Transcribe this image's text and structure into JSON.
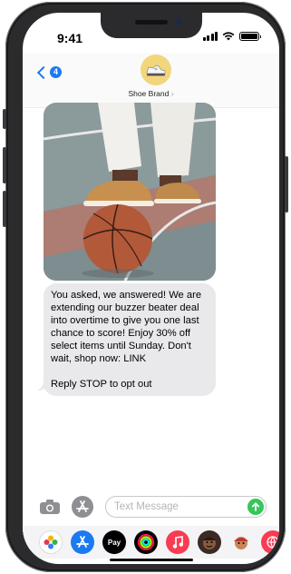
{
  "status_bar": {
    "time": "9:41"
  },
  "header": {
    "back_badge": "4",
    "contact_name": "Shoe Brand",
    "contact_chevron": "›"
  },
  "message": {
    "image_alt": "sneaker-on-basketball-photo",
    "text": "You asked, we answered! We are extending our buzzer beater deal into overtime to give you one last chance to score! Enjoy 30% off select items until Sunday. Don't wait, shop now: LINK\n\nReply STOP to opt out"
  },
  "composer": {
    "placeholder": "Text Message"
  },
  "app_drawer": {
    "apps": [
      "photos-app",
      "app-store-app",
      "apple-pay-app",
      "activity-app",
      "music-app",
      "memoji-app",
      "memoji-2-app",
      "web-app"
    ],
    "apple_pay_label": "Pay"
  },
  "colors": {
    "accent": "#1a7af2",
    "bubble": "#e9e9eb",
    "send": "#34c759"
  }
}
